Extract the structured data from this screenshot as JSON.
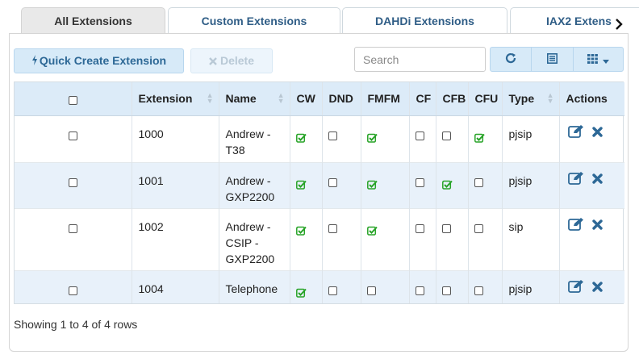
{
  "tabs": {
    "items": [
      {
        "label": "All Extensions",
        "active": true
      },
      {
        "label": "Custom Extensions",
        "active": false
      },
      {
        "label": "DAHDi Extensions",
        "active": false
      },
      {
        "label": "IAX2 Extens",
        "active": false
      }
    ],
    "next_icon": "chevron-right-icon"
  },
  "toolbar": {
    "quick_create_label": "Quick Create Extension",
    "quick_create_icon": "bolt-icon",
    "delete_label": "Delete",
    "delete_icon": "close-icon",
    "search_placeholder": "Search",
    "search_value": "",
    "refresh_icon": "refresh-icon",
    "toggle_view_icon": "list-icon",
    "columns_icon": "grid-icon"
  },
  "table": {
    "headers": {
      "extension": "Extension",
      "name": "Name",
      "cw": "CW",
      "dnd": "DND",
      "fmfm": "FMFM",
      "cf": "CF",
      "cfb": "CFB",
      "cfu": "CFU",
      "type": "Type",
      "actions": "Actions"
    },
    "rows": [
      {
        "extension": "1000",
        "name_lines": [
          "Andrew -",
          "T38"
        ],
        "cw": true,
        "dnd": false,
        "fmfm": true,
        "cf": false,
        "cfb": false,
        "cfu": true,
        "type": "pjsip"
      },
      {
        "extension": "1001",
        "name_lines": [
          "Andrew -",
          "GXP2200"
        ],
        "cw": true,
        "dnd": false,
        "fmfm": true,
        "cf": false,
        "cfb": true,
        "cfu": false,
        "type": "pjsip"
      },
      {
        "extension": "1002",
        "name_lines": [
          "Andrew -",
          "CSIP -",
          "GXP2200"
        ],
        "cw": true,
        "dnd": false,
        "fmfm": true,
        "cf": false,
        "cfb": false,
        "cfu": false,
        "type": "sip"
      },
      {
        "extension": "1004",
        "name_lines": [
          "Telephone"
        ],
        "cw": true,
        "dnd": false,
        "fmfm": false,
        "cf": false,
        "cfb": false,
        "cfu": false,
        "type": "pjsip"
      }
    ],
    "edit_icon": "edit-icon",
    "delete_icon": "delete-x-icon"
  },
  "footer": {
    "summary": "Showing 1 to 4 of 4 rows"
  },
  "colors": {
    "tab_text": "#2f5d86",
    "header_bg": "#dcebf8",
    "alt_row_bg": "#e8f1fa",
    "check_green": "#27a327",
    "action_blue": "#2d6896"
  }
}
